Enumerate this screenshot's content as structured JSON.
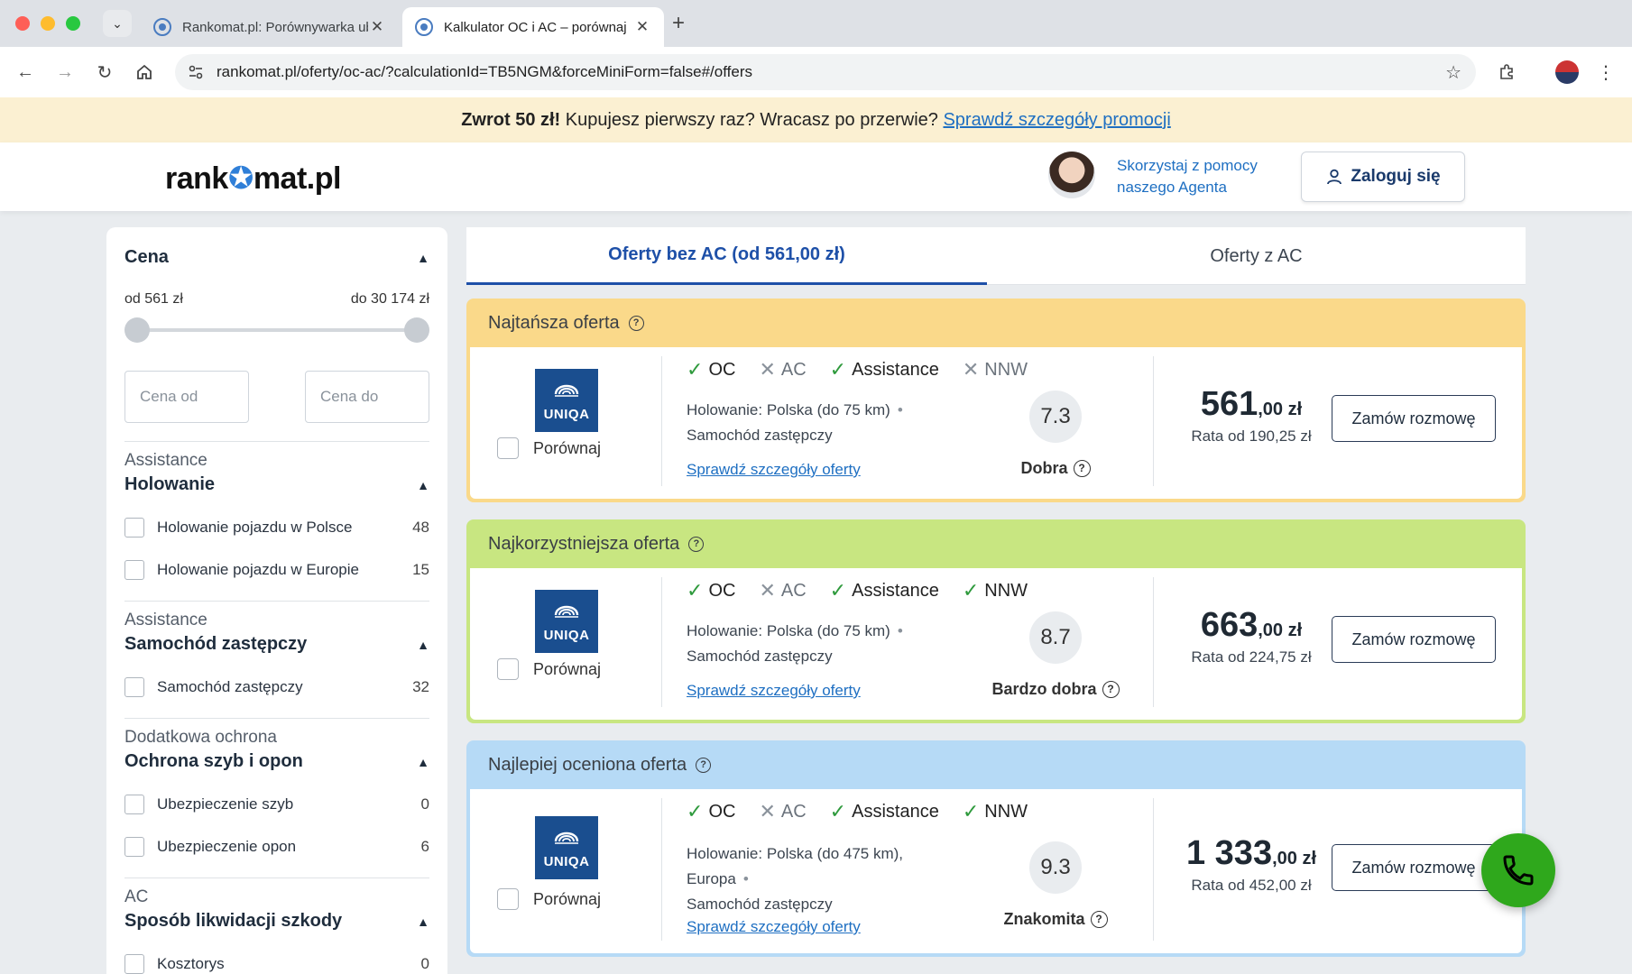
{
  "browser": {
    "tabs": [
      {
        "title": "Rankomat.pl: Porównywarka ubezpieczeń",
        "active": false
      },
      {
        "title": "Kalkulator OC i AC – porównaj",
        "active": true
      }
    ],
    "url": "rankomat.pl/oferty/oc-ac/?calculationId=TB5NGM&forceMiniForm=false#/offers",
    "icons": [
      "tab-search-icon",
      "back-icon",
      "forward-icon",
      "reload-icon",
      "home-icon",
      "site-settings-icon",
      "bookmark-star-icon",
      "extensions-icon",
      "menu-dots-icon"
    ]
  },
  "promo": {
    "bold": "Zwrot 50 zł!",
    "text": " Kupujesz pierwszy raz? Wracasz po przerwie? ",
    "link": "Sprawdź szczegóły promocji"
  },
  "header": {
    "logo_left": "rank",
    "logo_right": "mat.pl",
    "agent_line1": "Skorzystaj z pomocy",
    "agent_line2": "naszego Agenta",
    "login": "Zaloguj się"
  },
  "sidebar": {
    "price": {
      "title": "Cena",
      "from_label": "od 561 zł",
      "to_label": "do 30 174 zł",
      "from_placeholder": "Cena od",
      "to_placeholder": "Cena do"
    },
    "groups": [
      {
        "category": "Assistance",
        "title": "Holowanie",
        "items": [
          {
            "label": "Holowanie pojazdu w Polsce",
            "count": "48"
          },
          {
            "label": "Holowanie pojazdu w Europie",
            "count": "15"
          }
        ]
      },
      {
        "category": "Assistance",
        "title": "Samochód zastępczy",
        "items": [
          {
            "label": "Samochód zastępczy",
            "count": "32"
          }
        ]
      },
      {
        "category": "Dodatkowa ochrona",
        "title": "Ochrona szyb i opon",
        "items": [
          {
            "label": "Ubezpieczenie szyb",
            "count": "0"
          },
          {
            "label": "Ubezpieczenie opon",
            "count": "6"
          }
        ]
      },
      {
        "category": "AC",
        "title": "Sposób likwidacji szkody",
        "items": [
          {
            "label": "Kosztorys",
            "count": "0"
          }
        ]
      }
    ]
  },
  "offer_tabs": {
    "active": "Oferty bez AC (od 561,00 zł)",
    "inactive": "Oferty z AC"
  },
  "offers": [
    {
      "header": "Najtańsza oferta",
      "insurer": "UNIQA",
      "compare": "Porównaj",
      "features": [
        {
          "name": "OC",
          "included": true
        },
        {
          "name": "AC",
          "included": false
        },
        {
          "name": "Assistance",
          "included": true
        },
        {
          "name": "NNW",
          "included": false
        }
      ],
      "detail_line1": "Holowanie: Polska (do 75 km)",
      "detail_line2": "Samochód zastępczy",
      "details_link": "Sprawdź szczegóły oferty",
      "score": "7.3",
      "score_label": "Dobra",
      "price_main": "561",
      "price_dec": ",00 zł",
      "rate": "Rata od 190,25 zł",
      "order": "Zamów rozmowę",
      "header_color": "#fad98a"
    },
    {
      "header": "Najkorzystniejsza oferta",
      "insurer": "UNIQA",
      "compare": "Porównaj",
      "features": [
        {
          "name": "OC",
          "included": true
        },
        {
          "name": "AC",
          "included": false
        },
        {
          "name": "Assistance",
          "included": true
        },
        {
          "name": "NNW",
          "included": true
        }
      ],
      "detail_line1": "Holowanie: Polska (do 75 km)",
      "detail_line2": "Samochód zastępczy",
      "details_link": "Sprawdź szczegóły oferty",
      "score": "8.7",
      "score_label": "Bardzo dobra",
      "price_main": "663",
      "price_dec": ",00 zł",
      "rate": "Rata od 224,75 zł",
      "order": "Zamów rozmowę",
      "header_color": "#c8e681"
    },
    {
      "header": "Najlepiej oceniona oferta",
      "insurer": "UNIQA",
      "compare": "Porównaj",
      "features": [
        {
          "name": "OC",
          "included": true
        },
        {
          "name": "AC",
          "included": false
        },
        {
          "name": "Assistance",
          "included": true
        },
        {
          "name": "NNW",
          "included": true
        }
      ],
      "detail_line1": "Holowanie: Polska (do 475 km),",
      "detail_line1b": "Europa",
      "detail_line2": "Samochód zastępczy",
      "details_link": "Sprawdź szczegóły oferty",
      "score": "9.3",
      "score_label": "Znakomita",
      "price_main": "1 333",
      "price_dec": ",00 zł",
      "rate": "Rata od 452,00 zł",
      "order": "Zamów rozmowę",
      "header_color": "#b6daf6"
    }
  ],
  "colors": {
    "brand_blue": "#1e50a8",
    "link_blue": "#1e6fc2",
    "check_green": "#2e9a3c",
    "call_green": "#2fa81c",
    "uniqa_blue": "#1a4e8f"
  }
}
